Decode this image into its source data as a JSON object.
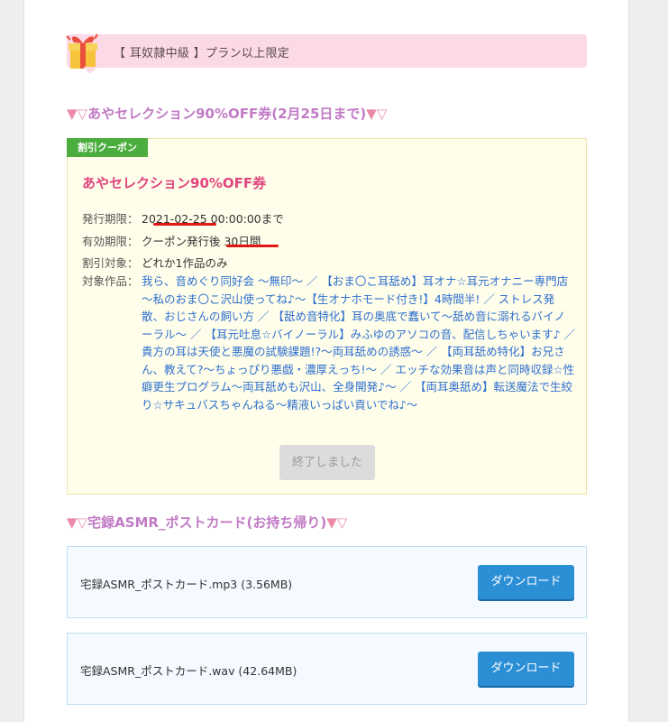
{
  "plan_banner": {
    "text": "【 耳奴隷中級 】プラン以上限定"
  },
  "section1": {
    "tri_left": "▼",
    "tri_left2": "▽",
    "title": "あやセレクション90%OFF券(2月25日まで)",
    "tri_right": "▼",
    "tri_right2": "▽"
  },
  "coupon": {
    "tag": "割引クーポン",
    "title": "あやセレクション90%OFF券",
    "issue_label": "発行期限：",
    "issue_value": "2021-02-25 00:00:00まで",
    "valid_label": "有効期限：",
    "valid_value": "クーポン発行後 30日間",
    "target_label": "割引対象：",
    "target_value": "どれか1作品のみ",
    "works_label": "対象作品：",
    "works_text": "我ら、音めぐり同好会 ～無印～ ／ 【おま〇こ耳舐め】耳オナ☆耳元オナニー専門店～私のおま〇こ沢山使ってね♪～【生オナホモード付き!】4時間半! ／ ストレス発散、おじさんの飼い方 ／ 【舐め音特化】耳の奥底で蠢いて～舐め音に溺れるバイノーラル～ ／ 【耳元吐息☆バイノーラル】みふゆのアソコの音、配信しちゃいます♪ ／ 貴方の耳は天使と悪魔の試験課題!?～両耳舐めの誘惑～ ／ 【両耳舐め特化】お兄さん、教えて?～ちょっぴり悪戯・濃厚えっち!～ ／ エッチな効果音は声と同時収録☆性癖更生プログラム～両耳舐めも沢山、全身開発♪～ ／ 【両耳奥舐め】転送魔法で生絞り☆サキュバスちゃんねる～精液いっぱい貢いでね♪～",
    "ended_button": "終了しました"
  },
  "section2": {
    "tri_left": "▼",
    "tri_left2": "▽",
    "title": "宅録ASMR_ポストカード(お持ち帰り)",
    "tri_right": "▼",
    "tri_right2": "▽"
  },
  "downloads": [
    {
      "filename": "宅録ASMR_ポストカード.mp3 (3.56MB)",
      "button": "ダウンロード"
    },
    {
      "filename": "宅録ASMR_ポストカード.wav (42.64MB)",
      "button": "ダウンロード"
    }
  ],
  "colors": {
    "banner_bg": "#fcd9e6",
    "section_heading": "#c17bc5",
    "coupon_title": "#e0457e",
    "coupon_tag": "#4aad3d",
    "link": "#2f6fcf",
    "download_button": "#2b8fd6",
    "annotation_red": "#e01616"
  }
}
